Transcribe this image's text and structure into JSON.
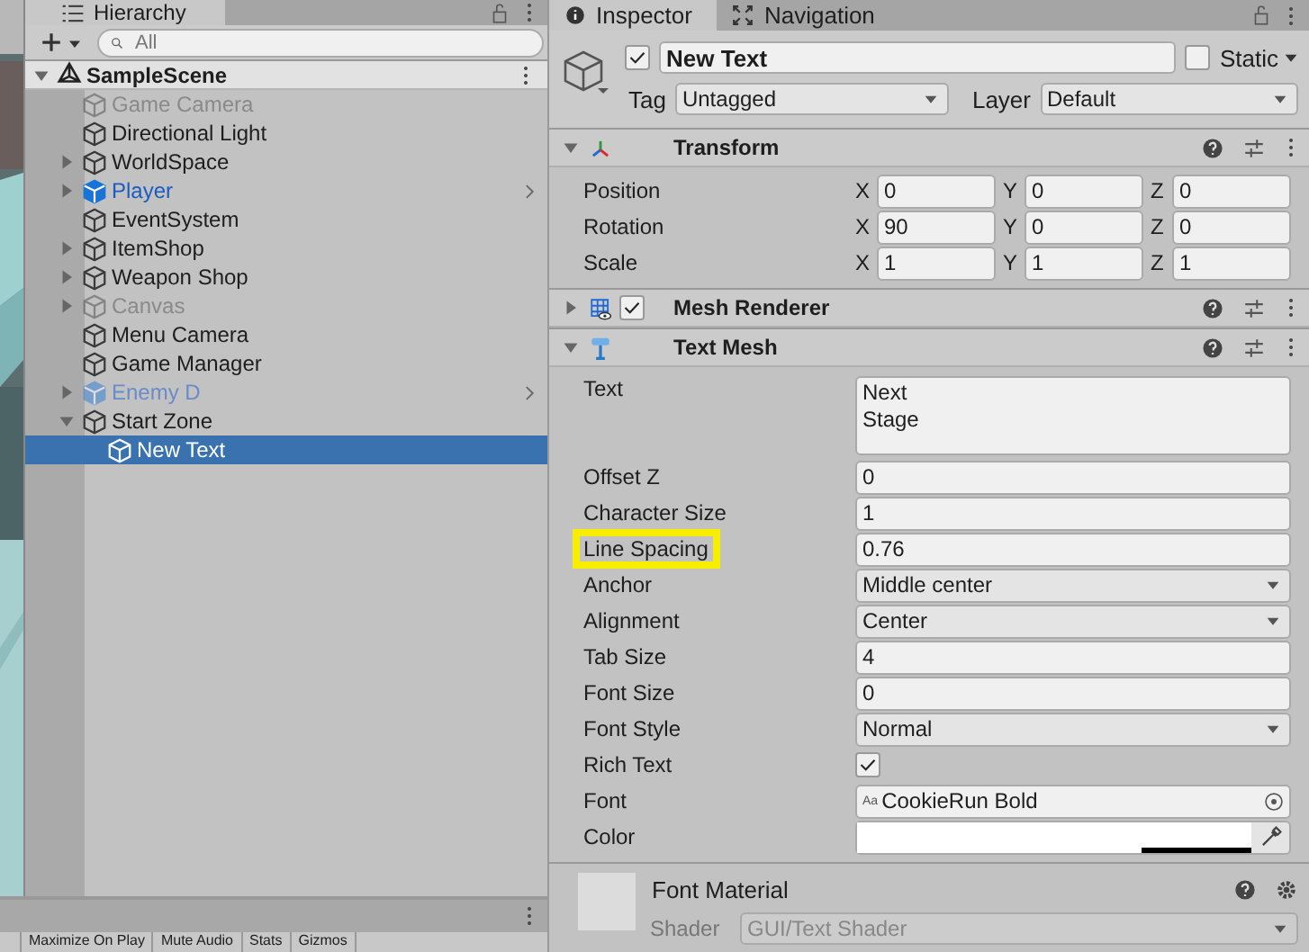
{
  "hierarchy": {
    "title": "Hierarchy",
    "search": {
      "placeholder": "All"
    },
    "scene": {
      "name": "SampleScene",
      "expanded": true,
      "children": [
        {
          "name": "Game Camera",
          "kind": "object",
          "disabled": true,
          "selected": false
        },
        {
          "name": "Directional Light",
          "kind": "object",
          "disabled": false,
          "selected": false
        },
        {
          "name": "WorldSpace",
          "kind": "object",
          "disabled": false,
          "expanded": false,
          "selected": false
        },
        {
          "name": "Player",
          "kind": "prefab",
          "disabled": false,
          "expanded": false,
          "selected": false
        },
        {
          "name": "EventSystem",
          "kind": "object",
          "disabled": false,
          "selected": false
        },
        {
          "name": "ItemShop",
          "kind": "object",
          "disabled": false,
          "expanded": false,
          "selected": false
        },
        {
          "name": "Weapon Shop",
          "kind": "object",
          "disabled": false,
          "expanded": false,
          "selected": false
        },
        {
          "name": "Canvas",
          "kind": "object",
          "disabled": true,
          "expanded": false,
          "selected": false
        },
        {
          "name": "Menu Camera",
          "kind": "object",
          "disabled": false,
          "selected": false
        },
        {
          "name": "Game Manager",
          "kind": "object",
          "disabled": false,
          "selected": false
        },
        {
          "name": "Enemy D",
          "kind": "prefab",
          "disabled": true,
          "expanded": false,
          "selected": false
        },
        {
          "name": "Start Zone",
          "kind": "object",
          "disabled": false,
          "expanded": true,
          "selected": false,
          "children": [
            {
              "name": "New Text",
              "kind": "object",
              "disabled": false,
              "selected": true
            }
          ]
        }
      ]
    }
  },
  "inspector": {
    "tabs": [
      {
        "label": "Inspector",
        "selected": true
      },
      {
        "label": "Navigation",
        "selected": false
      }
    ],
    "object": {
      "active": true,
      "name": "New Text",
      "static": false,
      "static_label": "Static",
      "tag_label": "Tag",
      "tag": "Untagged",
      "layer_label": "Layer",
      "layer": "Default"
    },
    "components": [
      {
        "kind": "transform",
        "title": "Transform",
        "expanded": true,
        "rows": [
          {
            "label": "Position",
            "fields": [
              {
                "axis": "X",
                "value": "0"
              },
              {
                "axis": "Y",
                "value": "0"
              },
              {
                "axis": "Z",
                "value": "0"
              }
            ]
          },
          {
            "label": "Rotation",
            "fields": [
              {
                "axis": "X",
                "value": "90"
              },
              {
                "axis": "Y",
                "value": "0"
              },
              {
                "axis": "Z",
                "value": "0"
              }
            ]
          },
          {
            "label": "Scale",
            "fields": [
              {
                "axis": "X",
                "value": "1"
              },
              {
                "axis": "Y",
                "value": "1"
              },
              {
                "axis": "Z",
                "value": "1"
              }
            ]
          }
        ]
      },
      {
        "kind": "mesh_renderer",
        "title": "Mesh Renderer",
        "expanded": false,
        "enabled": true
      },
      {
        "kind": "text_mesh",
        "title": "Text Mesh",
        "expanded": true,
        "properties": [
          {
            "kind": "textarea",
            "label": "Text",
            "value": "Next\nStage",
            "highlighted": false
          },
          {
            "kind": "field",
            "label": "Offset Z",
            "value": "0",
            "highlighted": false
          },
          {
            "kind": "field",
            "label": "Character Size",
            "value": "1",
            "highlighted": false
          },
          {
            "kind": "field",
            "label": "Line Spacing",
            "value": "0.76",
            "highlighted": true
          },
          {
            "kind": "dropdown",
            "label": "Anchor",
            "value": "Middle center",
            "highlighted": false
          },
          {
            "kind": "dropdown",
            "label": "Alignment",
            "value": "Center",
            "highlighted": false
          },
          {
            "kind": "field",
            "label": "Tab Size",
            "value": "4",
            "highlighted": false
          },
          {
            "kind": "field",
            "label": "Font Size",
            "value": "0",
            "highlighted": false
          },
          {
            "kind": "dropdown",
            "label": "Font Style",
            "value": "Normal",
            "highlighted": false
          },
          {
            "kind": "checkbox",
            "label": "Rich Text",
            "checked": true,
            "highlighted": false
          },
          {
            "kind": "object",
            "label": "Font",
            "value": "CookieRun Bold",
            "badge": "Aa",
            "highlighted": false
          },
          {
            "kind": "color",
            "label": "Color",
            "color": "#ffffff",
            "level": 0.72,
            "highlighted": false
          }
        ]
      }
    ],
    "material": {
      "title": "Font Material",
      "shader_label": "Shader",
      "shader": "GUI/Text Shader"
    }
  },
  "toolbar": {
    "items": [
      "Maximize On Play",
      "Mute Audio",
      "Stats",
      "Gizmos"
    ]
  }
}
